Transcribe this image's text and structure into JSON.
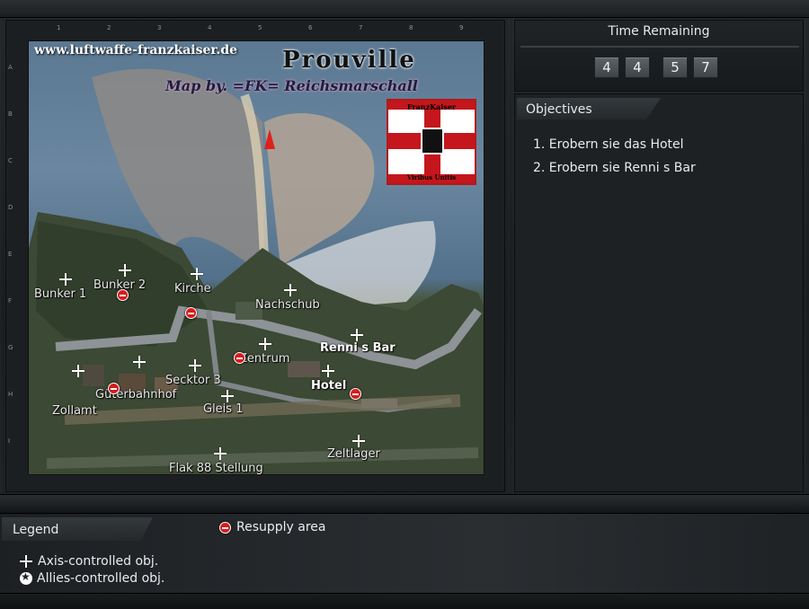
{
  "map": {
    "site": "www.luftwaffe-franzkaiser.de",
    "title": "Prouville",
    "credit": "Map by. =FK= Reichsmarschall",
    "flag_top": "FranzKaiser",
    "flag_bottom": "Viribus Unitis",
    "grid_cols": [
      "1",
      "2",
      "3",
      "4",
      "5",
      "6",
      "7",
      "8",
      "9"
    ],
    "grid_rows": [
      "A",
      "B",
      "C",
      "D",
      "E",
      "F",
      "G",
      "H",
      "I"
    ],
    "places": [
      {
        "id": "bunker1",
        "name": "Bunker 1",
        "type": "axis"
      },
      {
        "id": "bunker2",
        "name": "Bunker 2",
        "type": "axis"
      },
      {
        "id": "kirche",
        "name": "Kirche",
        "type": "axis"
      },
      {
        "id": "nachschub",
        "name": "Nachschub",
        "type": "axis"
      },
      {
        "id": "rennis",
        "name": "Renni s Bar",
        "type": "axis"
      },
      {
        "id": "zentrum",
        "name": "Zentrum",
        "type": "axis"
      },
      {
        "id": "sektor3",
        "name": "Secktor 3",
        "type": "axis"
      },
      {
        "id": "hotel",
        "name": "Hotel",
        "type": "axis"
      },
      {
        "id": "guterbahnhof",
        "name": "Güterbahnhof",
        "type": "axis"
      },
      {
        "id": "gleis1",
        "name": "Gleis 1",
        "type": "axis"
      },
      {
        "id": "zollamt",
        "name": "Zollamt",
        "type": "axis"
      },
      {
        "id": "zeltlager",
        "name": "Zeltlager",
        "type": "axis"
      },
      {
        "id": "flak88",
        "name": "Flak 88 Stellung",
        "type": "axis"
      }
    ]
  },
  "time": {
    "title": "Time Remaining",
    "digits": [
      "4",
      "4",
      "5",
      "7"
    ]
  },
  "objectives": {
    "title": "Objectives",
    "items": [
      "1. Erobern sie das Hotel",
      "2. Erobern sie Renni s Bar"
    ]
  },
  "legend": {
    "title": "Legend",
    "resupply": "Resupply area",
    "axis": "Axis-controlled obj.",
    "allies": "Allies-controlled obj."
  },
  "colors": {
    "resupply": "#d61c1c",
    "axis": "#ffffff",
    "panel": "#1d2124"
  }
}
